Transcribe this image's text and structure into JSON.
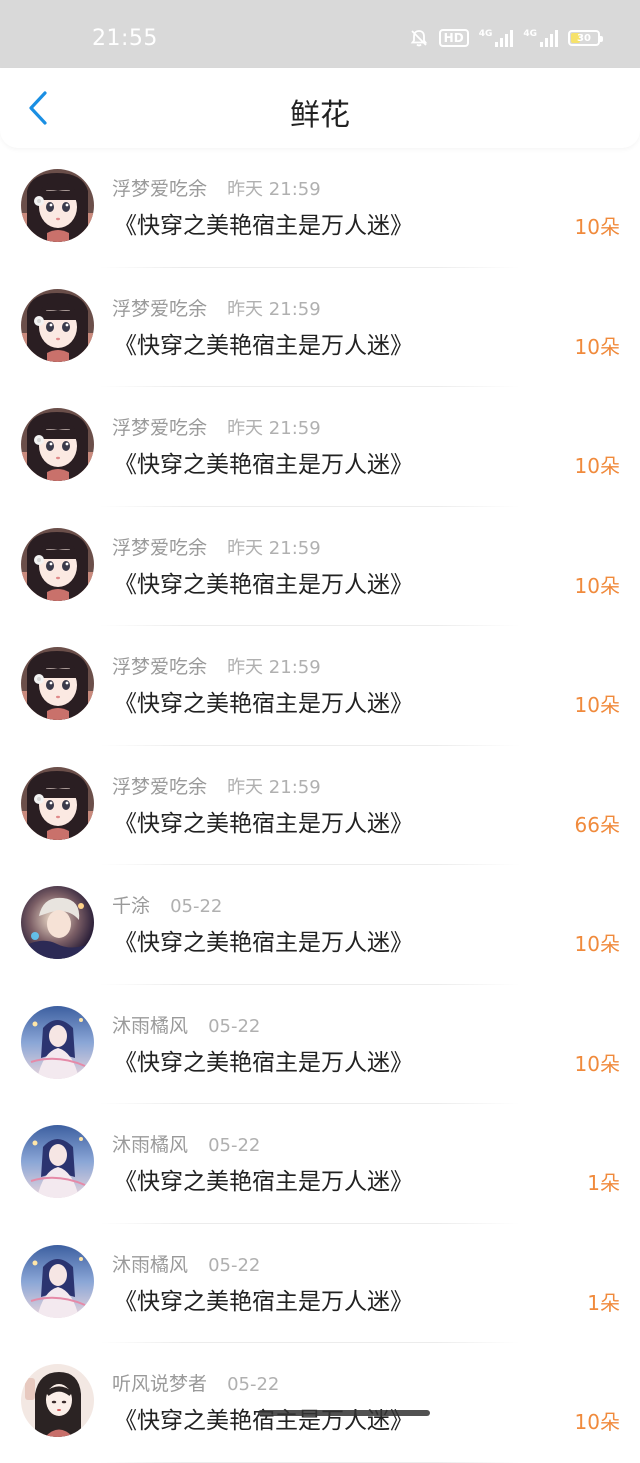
{
  "status_bar": {
    "time": "21:55",
    "hd_label": "HD",
    "network_1": "4G",
    "network_2": "4G",
    "battery": "30"
  },
  "header": {
    "title": "鲜花",
    "back_icon": "chevron-left-icon",
    "accent_color": "#1a8fe3"
  },
  "colors": {
    "count_color": "#f08a3c",
    "meta_color": "#9a9a9a",
    "title_color": "#222222"
  },
  "list": [
    {
      "avatar": "girl-black-hair",
      "name": "浮梦爱吃余",
      "time": "昨天 21:59",
      "book": "《快穿之美艳宿主是万人迷》",
      "count": "10朵"
    },
    {
      "avatar": "girl-black-hair",
      "name": "浮梦爱吃余",
      "time": "昨天 21:59",
      "book": "《快穿之美艳宿主是万人迷》",
      "count": "10朵"
    },
    {
      "avatar": "girl-black-hair",
      "name": "浮梦爱吃余",
      "time": "昨天 21:59",
      "book": "《快穿之美艳宿主是万人迷》",
      "count": "10朵"
    },
    {
      "avatar": "girl-black-hair",
      "name": "浮梦爱吃余",
      "time": "昨天 21:59",
      "book": "《快穿之美艳宿主是万人迷》",
      "count": "10朵"
    },
    {
      "avatar": "girl-black-hair",
      "name": "浮梦爱吃余",
      "time": "昨天 21:59",
      "book": "《快穿之美艳宿主是万人迷》",
      "count": "10朵"
    },
    {
      "avatar": "girl-black-hair",
      "name": "浮梦爱吃余",
      "time": "昨天 21:59",
      "book": "《快穿之美艳宿主是万人迷》",
      "count": "66朵"
    },
    {
      "avatar": "fantasy-boy",
      "name": "千涂",
      "time": "05-22",
      "book": "《快穿之美艳宿主是万人迷》",
      "count": "10朵"
    },
    {
      "avatar": "fairy-girl",
      "name": "沐雨橘风",
      "time": "05-22",
      "book": "《快穿之美艳宿主是万人迷》",
      "count": "10朵"
    },
    {
      "avatar": "fairy-girl",
      "name": "沐雨橘风",
      "time": "05-22",
      "book": "《快穿之美艳宿主是万人迷》",
      "count": "1朵"
    },
    {
      "avatar": "fairy-girl",
      "name": "沐雨橘风",
      "time": "05-22",
      "book": "《快穿之美艳宿主是万人迷》",
      "count": "1朵"
    },
    {
      "avatar": "ink-girl",
      "name": "听风说梦者",
      "time": "05-22",
      "book": "《快穿之美艳宿主是万人迷》",
      "count": "10朵"
    }
  ]
}
